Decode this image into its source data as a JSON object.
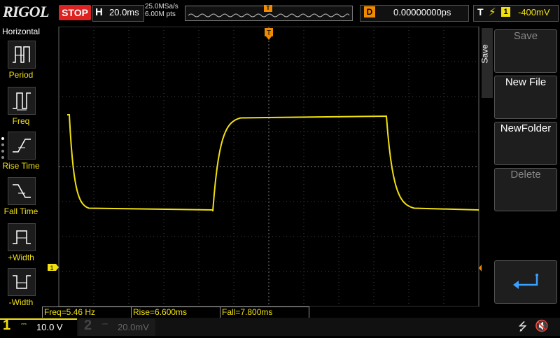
{
  "top": {
    "brand": "RIGOL",
    "run_status": "STOP",
    "timebase_letter": "H",
    "timebase": "20.0ms",
    "sample_rate": "25.0MSa/s",
    "memory_depth": "6.00M pts",
    "trigger_position_marker": "T",
    "delay_letter": "D",
    "delay": "0.00000000ps",
    "trigger_letter": "T",
    "trigger_source": "1",
    "trigger_level": "-400mV"
  },
  "left_menu": {
    "title": "Horizontal",
    "items": [
      {
        "label": "Period",
        "icon": "period-icon"
      },
      {
        "label": "Freq",
        "icon": "freq-icon"
      },
      {
        "label": "Rise Time",
        "icon": "rise-time-icon"
      },
      {
        "label": "Fall Time",
        "icon": "fall-time-icon"
      },
      {
        "label": "+Width",
        "icon": "pos-width-icon"
      },
      {
        "label": "-Width",
        "icon": "neg-width-icon"
      }
    ]
  },
  "right_menu": {
    "tab_label": "Save",
    "keys": [
      {
        "label": "Save",
        "enabled": false
      },
      {
        "label": "New File",
        "enabled": true
      },
      {
        "label": "NewFolder",
        "enabled": true
      },
      {
        "label": "Delete",
        "enabled": false
      },
      {
        "label": "",
        "icon": "return-arrow-icon",
        "enabled": true
      }
    ]
  },
  "markers": {
    "ch1_ground": "1",
    "trigger_top": "T"
  },
  "measurements": [
    {
      "text": "Freq=5.46 Hz"
    },
    {
      "text": "Rise=6.600ms"
    },
    {
      "text": "Fall=7.800ms"
    }
  ],
  "channels": [
    {
      "number": "1",
      "coupling": "DC",
      "scale": "10.0 V",
      "active": true
    },
    {
      "number": "2",
      "coupling": "DC",
      "scale": "20.0mV",
      "active": false
    }
  ],
  "colors": {
    "ch1": "#f0e010",
    "trigger": "#f08a00",
    "stop": "#dd2222"
  },
  "waveform": {
    "channel": "1",
    "levels_div": {
      "high": 2.2,
      "low": 0.6
    },
    "segments_div": [
      {
        "t": 0.0,
        "level": "high"
      },
      {
        "t": 0.2,
        "level": "fall"
      },
      {
        "t": 3.4,
        "level": "rise"
      },
      {
        "t": 7.0,
        "level": "fall"
      },
      {
        "t": 9.3,
        "level": "end"
      }
    ]
  }
}
